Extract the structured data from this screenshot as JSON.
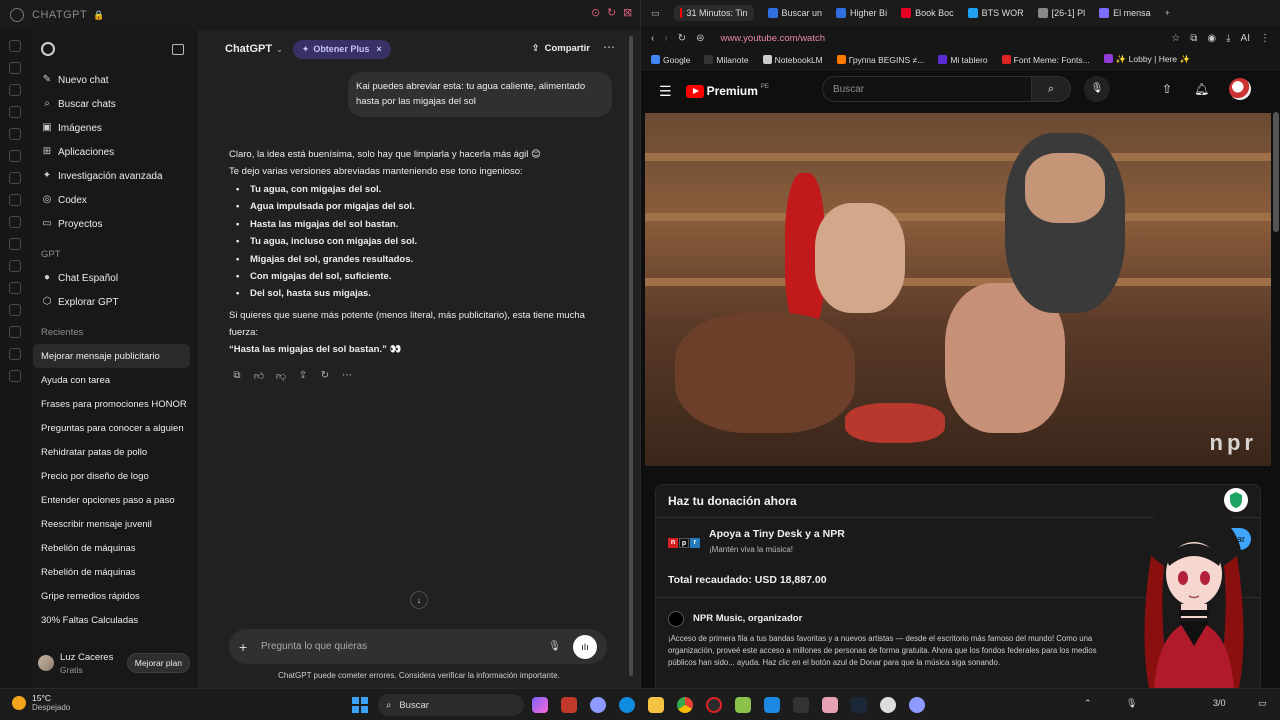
{
  "left_window": {
    "title": "CHATGPT"
  },
  "sidebar": {
    "items": [
      {
        "icon": "edit-icon",
        "label": "Nuevo chat"
      },
      {
        "icon": "search-icon",
        "label": "Buscar chats"
      },
      {
        "icon": "image-icon",
        "label": "Imágenes"
      },
      {
        "icon": "apps-icon",
        "label": "Aplicaciones"
      },
      {
        "icon": "research-icon",
        "label": "Investigación avanzada"
      },
      {
        "icon": "code-icon",
        "label": "Codex"
      },
      {
        "icon": "folder-icon",
        "label": "Proyectos"
      }
    ],
    "gpt_section_label": "GPT",
    "gpts": [
      {
        "icon": "chat-espanol-icon",
        "label": "Chat Español"
      },
      {
        "icon": "explore-icon",
        "label": "Explorar GPT"
      }
    ],
    "recents_label": "Recientes",
    "recents": [
      "Mejorar mensaje publicitario",
      "Ayuda con tarea",
      "Frases para promociones HONOR",
      "Preguntas para conocer a alguien",
      "Rehidratar patas de pollo",
      "Precio por diseño de logo",
      "Entender opciones paso a paso",
      "Reescribir mensaje juvenil",
      "Rebelión de máquinas",
      "Rebelión de máquinas",
      "Gripe remedios rápidos",
      "30% Faltas Calculadas"
    ],
    "user": {
      "name": "Luz Caceres",
      "plan": "Gratis",
      "upgrade_label": "Mejorar plan"
    }
  },
  "chat": {
    "model_name": "ChatGPT",
    "plus_pill": "Obtener Plus",
    "share_label": "Compartir",
    "user_message": "Kai puedes abreviar esta: tu agua caliente, alimentado hasta por las migajas del sol",
    "assistant_intro_1": "Claro, la idea está buenísima, solo hay que limpiarla y hacerla más ágil 😊",
    "assistant_intro_2": "Te dejo varias versiones abreviadas manteniendo ese tono ingenioso:",
    "assistant_bullets": [
      "Tu agua, con migajas del sol.",
      "Agua impulsada por migajas del sol.",
      "Hasta las migajas del sol bastan.",
      "Tu agua, incluso con migajas del sol.",
      "Migajas del sol, grandes resultados.",
      "Con migajas del sol, suficiente.",
      "Del sol, hasta sus migajas."
    ],
    "assistant_outro": "Si quieres que suene más potente (menos literal, más publicitario), esta tiene mucha fuerza:",
    "assistant_final": "“Hasta las migajas del sol bastan.” 👀",
    "composer_placeholder": "Pregunta lo que quieras",
    "disclaimer": "ChatGPT puede cometer errores. Considera verificar la información importante."
  },
  "browser": {
    "tabs": [
      {
        "label": "31 Minutos: Tin",
        "color": "#ff0000",
        "active": true
      },
      {
        "label": "Buscar un",
        "color": "#2f6fe0",
        "active": false
      },
      {
        "label": "Higher Bi",
        "color": "#2f6fe0",
        "active": false
      },
      {
        "label": "Book Boc",
        "color": "#e60023",
        "active": false
      },
      {
        "label": "BTS WOR",
        "color": "#1da1f2",
        "active": false
      },
      {
        "label": "[26-1] Pl",
        "color": "#888888",
        "active": false
      },
      {
        "label": "El mensa",
        "color": "#7b6cff",
        "active": false
      }
    ],
    "url": "www.youtube.com/watch",
    "ai_label": "AI",
    "bookmarks": [
      {
        "label": "Google",
        "color": "#4285f4"
      },
      {
        "label": "Milanote",
        "color": "#333333"
      },
      {
        "label": "NotebookLM",
        "color": "#cccccc"
      },
      {
        "label": "Группа BEGINS ≠...",
        "color": "#ff7a00"
      },
      {
        "label": "Mi tablero",
        "color": "#5b2bd6"
      },
      {
        "label": "Font Meme: Fonts...",
        "color": "#e02424"
      },
      {
        "label": "✨ Lobby | Here ✨",
        "color": "#8e3bd8"
      }
    ]
  },
  "youtube": {
    "logo_word": "Premium",
    "logo_country": "PE",
    "search_placeholder": "Buscar",
    "video_watermark": "npr"
  },
  "donation": {
    "title": "Haz tu donación ahora",
    "heading": "Apoya a Tiny Desk y a NPR",
    "subheading": "¡Mantén viva la música!",
    "button_label": "Donar",
    "total_raised": "Total recaudado: USD 18,887.00",
    "organizer": "NPR Music, organizador",
    "description": "¡Acceso de primera fila a tus bandas favoritas y a nuevos artistas — desde el escritorio más famoso del mundo! Como una organización, proveé este acceso a millones de personas de forma gratuita. Ahora que los fondos federales para los medios públicos han sido... ayuda. Haz clic en el botón azul de Donar para que la música siga sonando."
  },
  "taskbar": {
    "temperature": "15°C",
    "condition": "Despejado",
    "search_label": "Buscar",
    "clock_partial": "3/0"
  }
}
